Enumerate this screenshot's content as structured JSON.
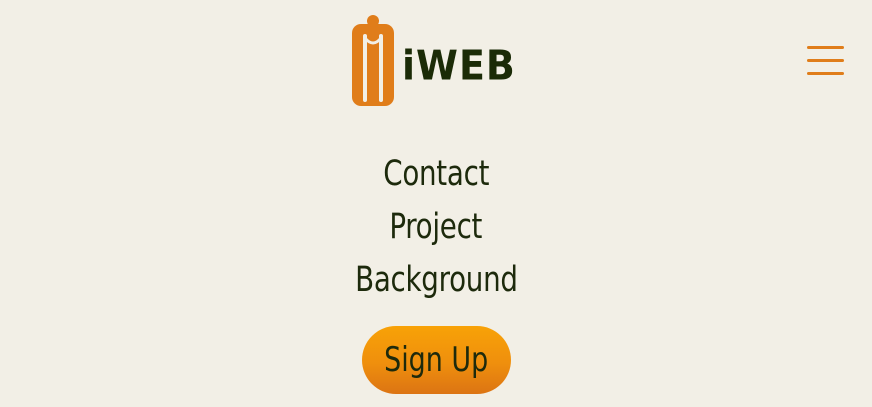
{
  "brand": {
    "logo_text": "iWEB",
    "accent_color": "#e07d1a",
    "dark_color": "#1d2a0c"
  },
  "header": {
    "menu_icon": "hamburger-menu-icon"
  },
  "nav": {
    "items": [
      {
        "label": "Contact"
      },
      {
        "label": "Project"
      },
      {
        "label": "Background"
      }
    ]
  },
  "cta": {
    "signup_label": "Sign Up"
  }
}
